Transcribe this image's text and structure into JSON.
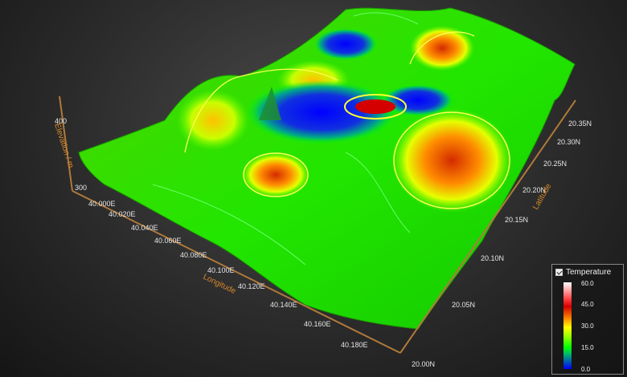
{
  "chart_data": {
    "type": "surface3d",
    "x_axis": {
      "title": "Longitude",
      "ticks": [
        "40.000E",
        "40.020E",
        "40.040E",
        "40.060E",
        "40.080E",
        "40.100E",
        "40.120E",
        "40.140E",
        "40.160E",
        "40.180E"
      ]
    },
    "y_axis": {
      "title": "Latitude",
      "ticks": [
        "20.00N",
        "20.05N",
        "20.10N",
        "20.15N",
        "20.20N",
        "20.25N",
        "20.30N",
        "20.35N"
      ]
    },
    "z_axis": {
      "title": "Elevation / m",
      "ticks": [
        "300",
        "400"
      ]
    },
    "color_legend": {
      "title": "Temperature",
      "checked": true,
      "ticks": [
        "60.0",
        "45.0",
        "30.0",
        "15.0",
        "0.0"
      ],
      "range": [
        0,
        60
      ]
    },
    "colors": {
      "cold": "#0000ff",
      "cool": "#00c060",
      "mild": "#00ff00",
      "warm": "#ffff00",
      "hot": "#ff3b00",
      "max": "#ffffff",
      "contour": "#ffff66",
      "axis": "#d98a2b"
    }
  }
}
